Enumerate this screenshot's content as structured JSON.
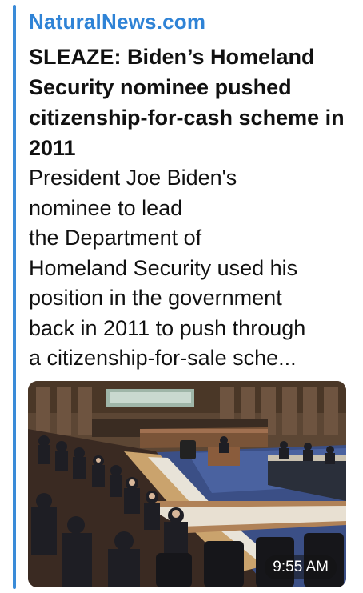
{
  "message": {
    "site_name": "NaturalNews.com",
    "headline": "SLEAZE: Biden’s Homeland Security nominee pushed citizenship-for-cash scheme in 2011",
    "summary_lines": [
      "President Joe Biden's",
      "nominee to lead",
      "the Department of",
      "Homeland Security used his",
      "position in the government",
      "back in 2011 to push through",
      "a citizenship-for-sale sche..."
    ],
    "timestamp": "9:55 AM"
  },
  "colors": {
    "accent": "#3a8bd8",
    "site_name": "#2f83d6"
  }
}
